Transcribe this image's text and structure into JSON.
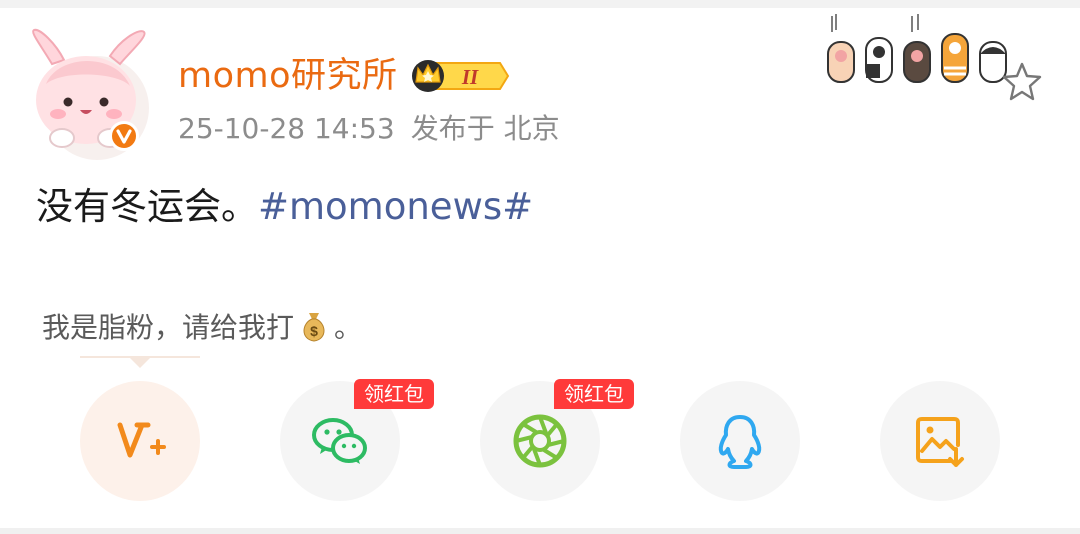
{
  "post": {
    "username": "momo研究所",
    "level_badge": "II",
    "timestamp": "25-10-28 14:53",
    "location": "发布于 北京",
    "text": "没有冬运会。",
    "hashtag": "#momonews#"
  },
  "fans_note": {
    "text_before": "我是脂粉，请给我打",
    "text_after": "。"
  },
  "share": {
    "items": [
      {
        "name": "vplus",
        "icon": "v-plus-icon",
        "color": "#f28a1c"
      },
      {
        "name": "wechat",
        "icon": "wechat-icon",
        "color": "#2dbb63",
        "badge": "领红包"
      },
      {
        "name": "moments",
        "icon": "moments-icon",
        "color": "#7bc23e",
        "badge": "领红包"
      },
      {
        "name": "qq",
        "icon": "qq-icon",
        "color": "#2fa8f0"
      },
      {
        "name": "save-image",
        "icon": "save-image-icon",
        "color": "#f5a21b"
      }
    ]
  },
  "colors": {
    "username": "#ea6a11",
    "hashtag": "#4a5f99",
    "redpack": "#ff3a3a",
    "verified": "#f27a12"
  }
}
